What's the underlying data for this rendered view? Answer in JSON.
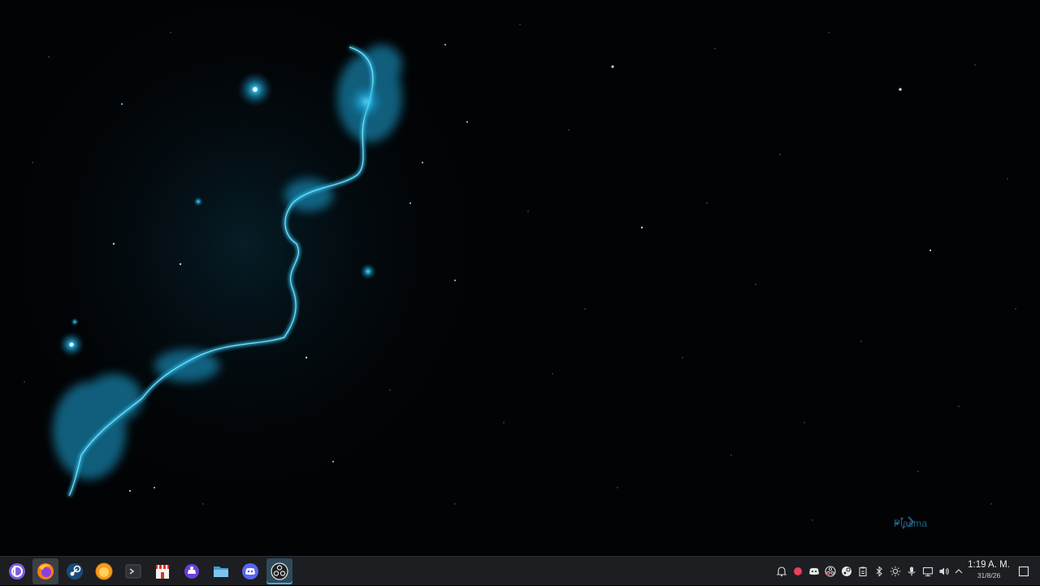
{
  "desktop": {
    "wallpaper": "blue-nebula-starfield",
    "watermark_text": "Plasma"
  },
  "taskbar": {
    "launcher": {
      "icon": "kde-application-launcher-icon"
    },
    "tasks": [
      {
        "name": "firefox",
        "icon": "firefox-icon",
        "active": true
      },
      {
        "name": "steam",
        "icon": "steam-icon",
        "active": false
      },
      {
        "name": "orange-app",
        "icon": "orange-circle-app-icon",
        "active": false
      },
      {
        "name": "terminal",
        "icon": "terminal-icon",
        "active": false
      },
      {
        "name": "store",
        "icon": "store-icon",
        "active": false
      },
      {
        "name": "discover",
        "icon": "discover-icon",
        "active": false
      },
      {
        "name": "file-manager",
        "icon": "folder-icon",
        "active": false
      },
      {
        "name": "discord",
        "icon": "discord-icon",
        "active": false
      },
      {
        "name": "obs",
        "icon": "obs-icon",
        "active": true
      }
    ],
    "tray": [
      {
        "name": "notifications",
        "icon": "bell-icon"
      },
      {
        "name": "recording",
        "icon": "record-dot-icon"
      },
      {
        "name": "discord-tray",
        "icon": "discord-icon"
      },
      {
        "name": "obs-tray",
        "icon": "obs-icon"
      },
      {
        "name": "steam-tray",
        "icon": "steam-icon"
      },
      {
        "name": "clipboard",
        "icon": "clipboard-icon"
      },
      {
        "name": "bluetooth",
        "icon": "bluetooth-icon"
      },
      {
        "name": "brightness",
        "icon": "brightness-icon"
      },
      {
        "name": "microphone",
        "icon": "microphone-icon"
      },
      {
        "name": "network",
        "icon": "network-icon"
      },
      {
        "name": "volume",
        "icon": "volume-icon"
      },
      {
        "name": "expand-tray",
        "icon": "chevron-up-icon"
      }
    ],
    "clock": {
      "time": "1:19 A. M.",
      "date": "31/8/26"
    }
  },
  "colors": {
    "accent": "#3daee9",
    "panel": "#1c1e21",
    "nebula": "#22c3f2"
  }
}
